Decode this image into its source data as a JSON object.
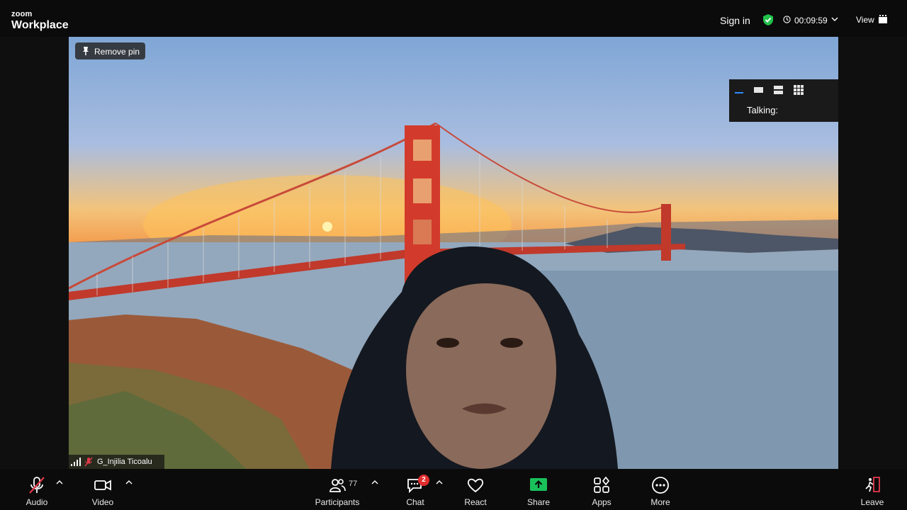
{
  "app": {
    "brand_small": "zoom",
    "brand_large": "Workplace"
  },
  "header": {
    "signin_label": "Sign in",
    "timer": "00:09:59",
    "view_label": "View"
  },
  "video": {
    "remove_pin_label": "Remove pin",
    "talking_label": "Talking:",
    "participant_name": "G_Injilia Ticoalu"
  },
  "toolbar": {
    "audio_label": "Audio",
    "video_label": "Video",
    "participants_label": "Participants",
    "participants_count": "77",
    "chat_label": "Chat",
    "chat_badge": "2",
    "react_label": "React",
    "share_label": "Share",
    "apps_label": "Apps",
    "more_label": "More",
    "leave_label": "Leave"
  },
  "colors": {
    "share_green": "#19c15b",
    "shield_green": "#21c14a",
    "badge_red": "#e02d2d",
    "accent_blue": "#2d8cff",
    "mute_red": "#e0394a"
  }
}
